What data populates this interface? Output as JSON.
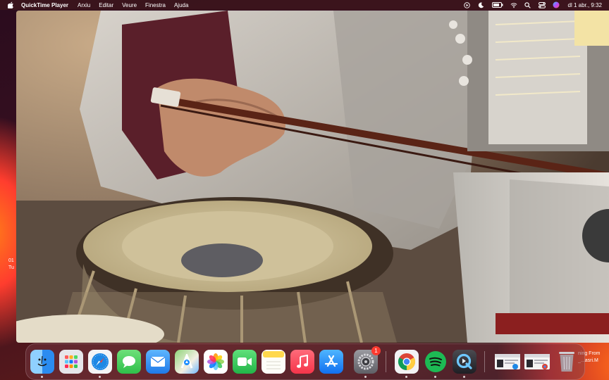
{
  "menubar": {
    "app_name": "QuickTime Player",
    "menus": [
      "Arxiu",
      "Editar",
      "Veure",
      "Finestra",
      "Ajuda"
    ],
    "status_icons": [
      "play-circle-icon",
      "moon-icon",
      "battery-icon",
      "wifi-icon",
      "search-icon",
      "control-center-icon",
      "siri-icon"
    ],
    "clock": "dl 1 abr., 9:32"
  },
  "desktop": {
    "widget_line1": "01",
    "widget_line2": "Tu",
    "note_line1": "ning From",
    "note_line2": "_...asri.M"
  },
  "video": {
    "subject": "tabla and bowed string instrument"
  },
  "dock": {
    "apps": [
      {
        "name": "Finder",
        "icon": "finder-icon",
        "color": "#2b8cf0",
        "running": true
      },
      {
        "name": "Launchpad",
        "icon": "launchpad-icon",
        "color": "#e6e6ea",
        "running": false
      },
      {
        "name": "Safari",
        "icon": "safari-icon",
        "color": "#1e88e5",
        "running": true
      },
      {
        "name": "Messages",
        "icon": "messages-icon",
        "color": "#34c759",
        "running": false
      },
      {
        "name": "Mail",
        "icon": "mail-icon",
        "color": "#2e8bf0",
        "running": false
      },
      {
        "name": "Maps",
        "icon": "maps-icon",
        "color": "#4caf50",
        "running": false
      },
      {
        "name": "Photos",
        "icon": "photos-icon",
        "color": "#ffffff",
        "running": false
      },
      {
        "name": "FaceTime",
        "icon": "facetime-icon",
        "color": "#30c75a",
        "running": false
      },
      {
        "name": "Notes",
        "icon": "notes-icon",
        "color": "#ffd84d",
        "running": false
      },
      {
        "name": "Music",
        "icon": "music-icon",
        "color": "#fc3c44",
        "running": false
      },
      {
        "name": "App Store",
        "icon": "app-store-icon",
        "color": "#1a8cff",
        "running": false
      },
      {
        "name": "System Settings",
        "icon": "system-settings-icon",
        "color": "#8e8e93",
        "running": true,
        "badge": "1"
      },
      {
        "name": "Chrome",
        "icon": "chrome-icon",
        "color": "#ffffff",
        "running": true
      },
      {
        "name": "Spotify",
        "icon": "spotify-icon",
        "color": "#1db954",
        "running": true
      },
      {
        "name": "QuickTime Player",
        "icon": "quicktime-icon",
        "color": "#3a3a3c",
        "running": true
      }
    ],
    "minimized": [
      {
        "name": "minimized-window-1",
        "icon": "minimized-window-icon"
      },
      {
        "name": "minimized-window-2",
        "icon": "minimized-window-icon"
      }
    ],
    "trash": {
      "name": "Trash",
      "icon": "trash-icon"
    }
  }
}
